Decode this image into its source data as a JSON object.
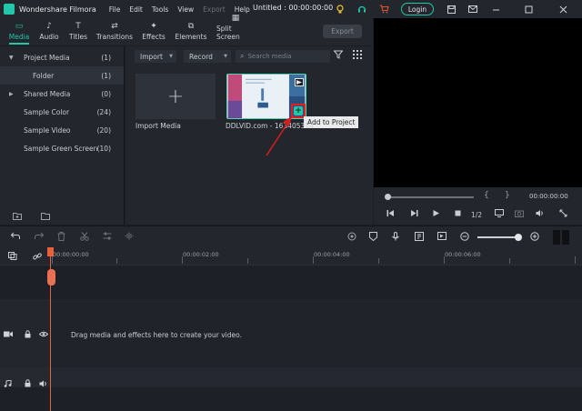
{
  "app": {
    "name": "Wondershare Filmora",
    "logo_letter": "",
    "document_title": "Untitled : 00:00:00:00"
  },
  "menu": [
    "File",
    "Edit",
    "Tools",
    "View",
    "Export",
    "Help"
  ],
  "titlebar": {
    "login_label": "Login"
  },
  "tabs": [
    {
      "label": "Media",
      "icon": "folder-icon",
      "active": true
    },
    {
      "label": "Audio",
      "icon": "music-note-icon",
      "active": false
    },
    {
      "label": "Titles",
      "icon": "text-t-icon",
      "active": false
    },
    {
      "label": "Transitions",
      "icon": "transition-icon",
      "active": false
    },
    {
      "label": "Effects",
      "icon": "effects-icon",
      "active": false
    },
    {
      "label": "Elements",
      "icon": "elements-icon",
      "active": false
    },
    {
      "label": "Split Screen",
      "icon": "split-screen-icon",
      "active": false
    }
  ],
  "toolbar": {
    "export_label": "Export"
  },
  "library": {
    "items": [
      {
        "label": "Project Media",
        "count": "(1)",
        "arrow": "▼"
      },
      {
        "label": "Folder",
        "count": "(1)",
        "arrow": ""
      },
      {
        "label": "Shared Media",
        "count": "(0)",
        "arrow": "▶"
      },
      {
        "label": "Sample Color",
        "count": "(24)",
        "arrow": ""
      },
      {
        "label": "Sample Video",
        "count": "(20)",
        "arrow": ""
      },
      {
        "label": "Sample Green Screen",
        "count": "(10)",
        "arrow": ""
      }
    ]
  },
  "media": {
    "import_label": "Import",
    "record_label": "Record",
    "search_placeholder": "Search media",
    "import_tile_label": "Import Media",
    "clip_label": "DDLVID.com - 163405314...",
    "add_tooltip": "Add to Project"
  },
  "preview": {
    "timecode": "00:00:00:00",
    "quality": "1/2"
  },
  "timeline": {
    "timecodes": [
      "00:00:00:00",
      "00:00:02:00",
      "00:00:04:00",
      "00:00:06:00"
    ],
    "drop_hint": "Drag media and effects here to create your video."
  },
  "colors": {
    "accent": "#22c6a8",
    "highlight": "#e02020",
    "playhead": "#e9613a"
  }
}
